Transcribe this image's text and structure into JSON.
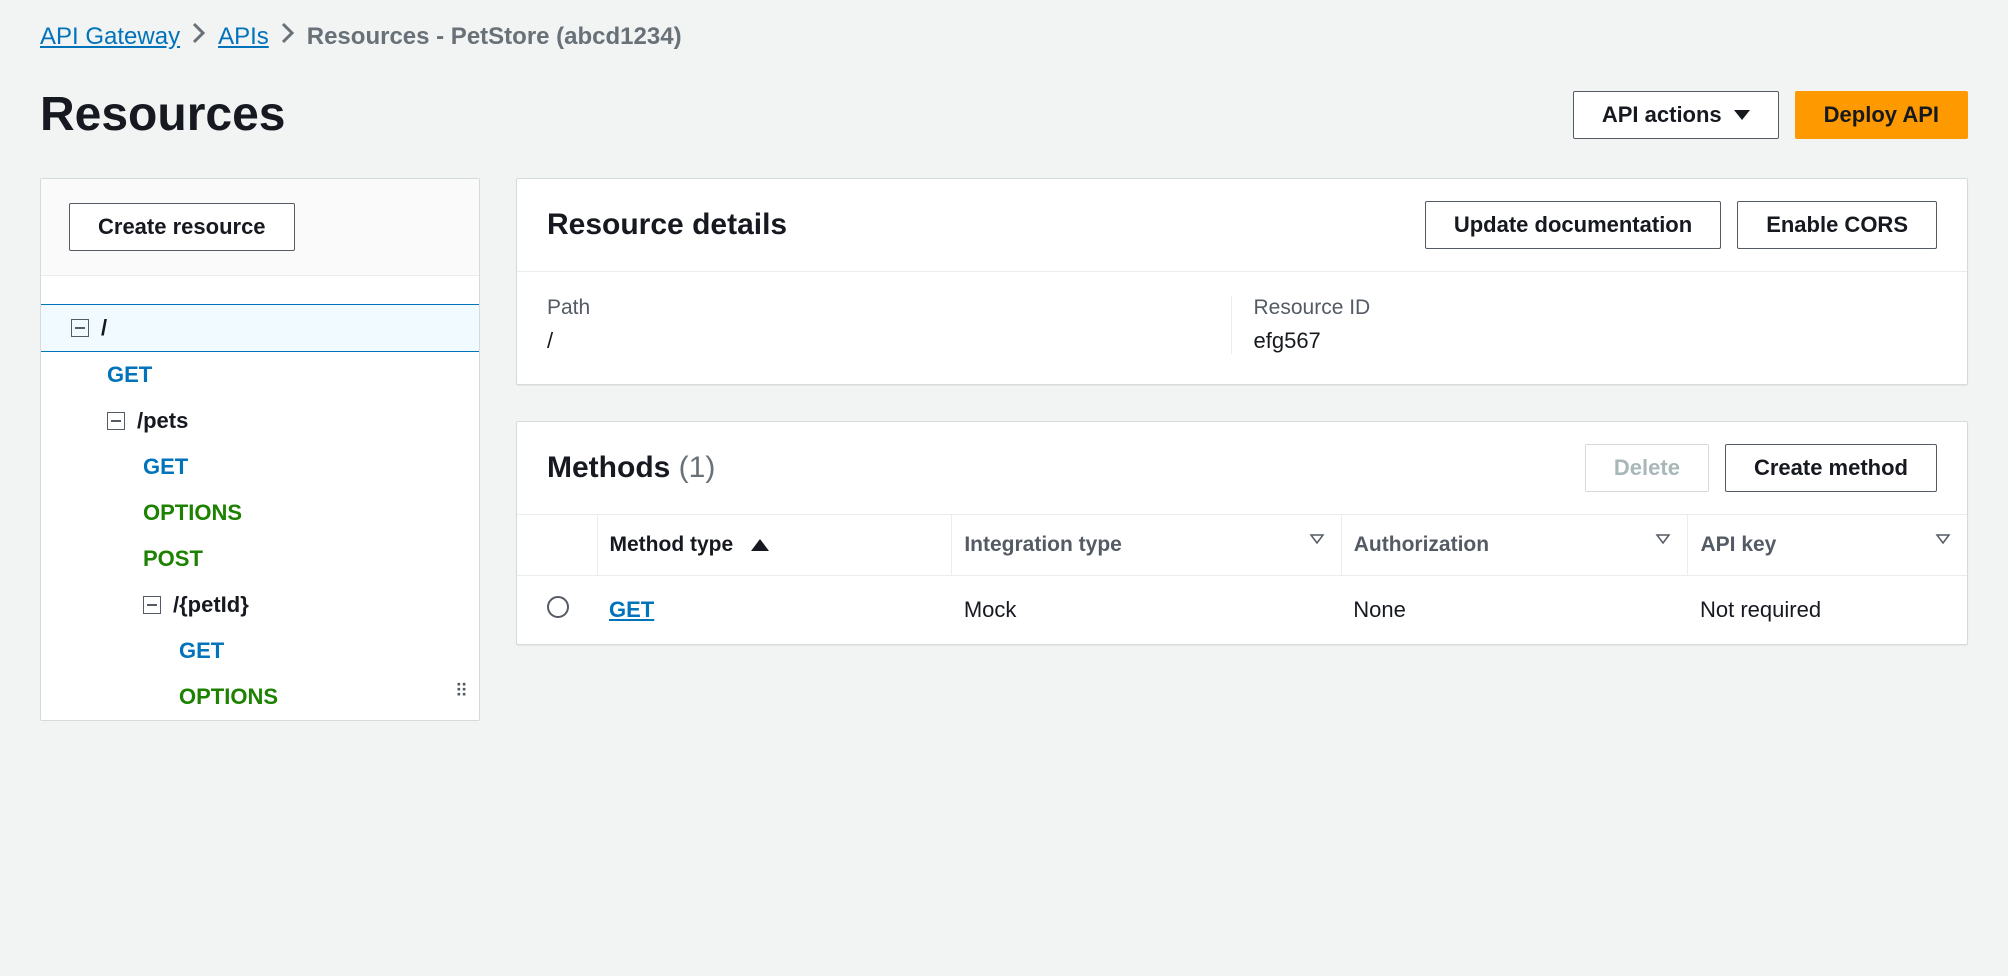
{
  "breadcrumb": {
    "link1": "API Gateway",
    "link2": "APIs",
    "current": "Resources - PetStore (abcd1234)"
  },
  "header": {
    "title": "Resources",
    "api_actions_label": "API actions",
    "deploy_label": "Deploy API"
  },
  "sidebar": {
    "create_resource_label": "Create resource",
    "tree": {
      "root": "/",
      "root_methods": [
        "GET"
      ],
      "pets": "/pets",
      "pets_methods": [
        "GET",
        "OPTIONS",
        "POST"
      ],
      "petid": "/{petId}",
      "petid_methods": [
        "GET",
        "OPTIONS"
      ]
    }
  },
  "resource_details": {
    "title": "Resource details",
    "update_doc_label": "Update documentation",
    "enable_cors_label": "Enable CORS",
    "path_label": "Path",
    "path_value": "/",
    "resource_id_label": "Resource ID",
    "resource_id_value": "efg567"
  },
  "methods": {
    "title": "Methods",
    "count": "(1)",
    "delete_label": "Delete",
    "create_label": "Create method",
    "columns": {
      "method_type": "Method type",
      "integration_type": "Integration type",
      "authorization": "Authorization",
      "api_key": "API key"
    },
    "rows": [
      {
        "method": "GET",
        "integration": "Mock",
        "auth": "None",
        "api_key": "Not required"
      }
    ]
  }
}
